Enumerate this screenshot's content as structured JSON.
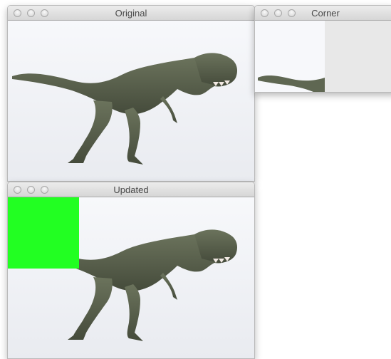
{
  "windows": {
    "original": {
      "title": "Original"
    },
    "corner": {
      "title": "Corner"
    },
    "updated": {
      "title": "Updated"
    }
  },
  "icons": {
    "close": "close-button",
    "minimize": "minimize-button",
    "zoom": "zoom-button"
  },
  "colors": {
    "overlay_green": "#22ff22",
    "corner_fill": "#e8e8e8",
    "image_bg": "#f1f2f6",
    "dino_body": "#5e6650"
  }
}
